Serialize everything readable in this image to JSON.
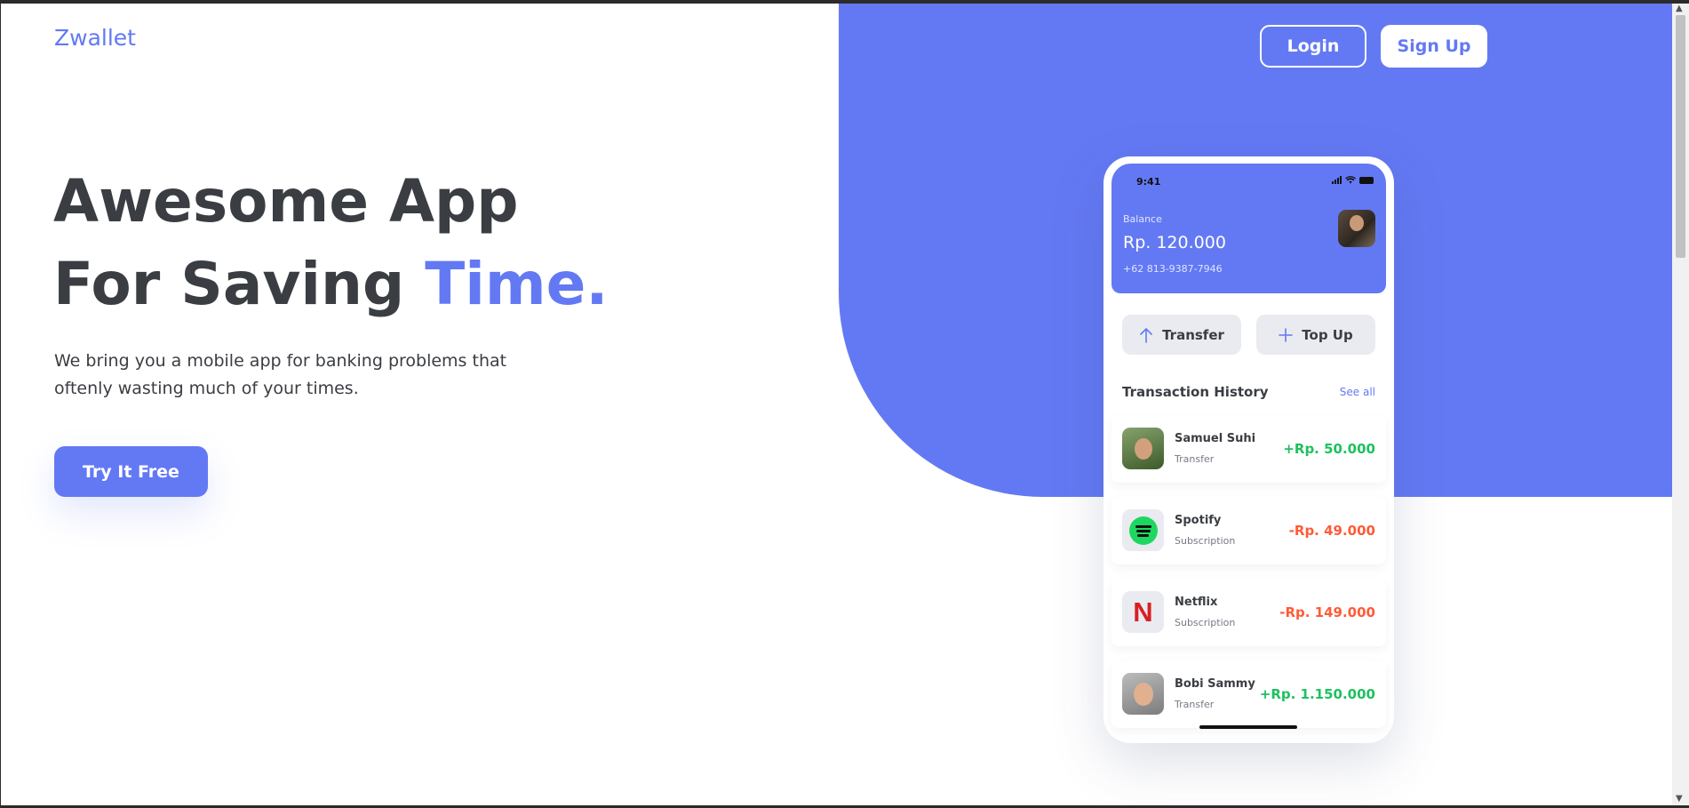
{
  "brand": "Zwallet",
  "nav": {
    "login": "Login",
    "signup": "Sign Up"
  },
  "hero": {
    "line1": "Awesome App",
    "line2": "For Saving ",
    "accent": "Time.",
    "description": "We bring you a mobile app for banking problems that oftenly wasting much of your times.",
    "cta": "Try It Free"
  },
  "phone": {
    "status_time": "9:41",
    "balance_label": "Balance",
    "balance_value": "Rp. 120.000",
    "phone_number": "+62 813-9387-7946",
    "actions": {
      "transfer": "Transfer",
      "topup": "Top Up"
    },
    "history_title": "Transaction History",
    "see_all": "See all",
    "transactions": [
      {
        "name": "Samuel Suhi",
        "type": "Transfer",
        "amount": "+Rp. 50.000"
      },
      {
        "name": "Spotify",
        "type": "Subscription",
        "amount": "-Rp. 49.000"
      },
      {
        "name": "Netflix",
        "type": "Subscription",
        "amount": "-Rp. 149.000"
      },
      {
        "name": "Bobi Sammy",
        "type": "Transfer",
        "amount": "+Rp. 1.150.000"
      }
    ],
    "netflix_glyph": "N"
  },
  "icons": {
    "transfer": "arrow-up-icon",
    "topup": "plus-icon"
  },
  "colors": {
    "accent": "#6379f4",
    "positive": "#1ec15f",
    "negative": "#ff5b37",
    "text": "#3a3d42"
  }
}
